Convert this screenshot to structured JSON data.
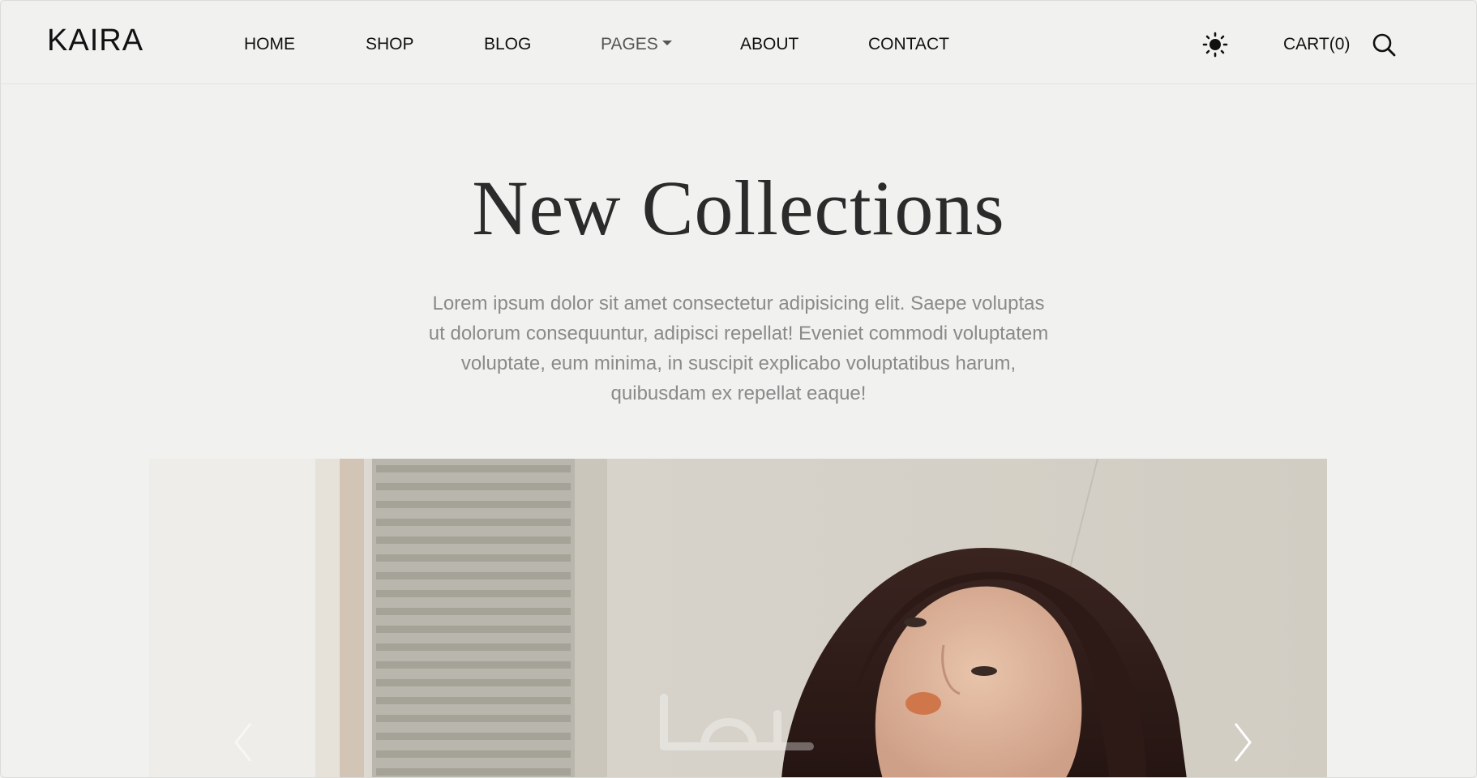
{
  "header": {
    "logo": "KAIRA",
    "nav": [
      {
        "label": "HOME"
      },
      {
        "label": "SHOP"
      },
      {
        "label": "BLOG"
      },
      {
        "label": "PAGES"
      },
      {
        "label": "ABOUT"
      },
      {
        "label": "CONTACT"
      }
    ],
    "theme_icon": "sun-icon",
    "cart_label": "CART(0)",
    "search_icon": "search-icon"
  },
  "hero": {
    "title": "New Collections",
    "description": "Lorem ipsum dolor sit amet consectetur adipisicing elit. Saepe voluptas ut dolorum consequuntur, adipisci repellat! Eveniet commodi voluptatem voluptate, eum minima, in suscipit explicabo voluptatibus harum, quibusdam ex repellat eaque!"
  },
  "slider": {
    "prev_icon": "chevron-left-icon",
    "next_icon": "chevron-right-icon"
  },
  "colors": {
    "page_background": "#f1f1ef",
    "text_dark": "#222222",
    "text_muted": "#8a8a8a"
  }
}
